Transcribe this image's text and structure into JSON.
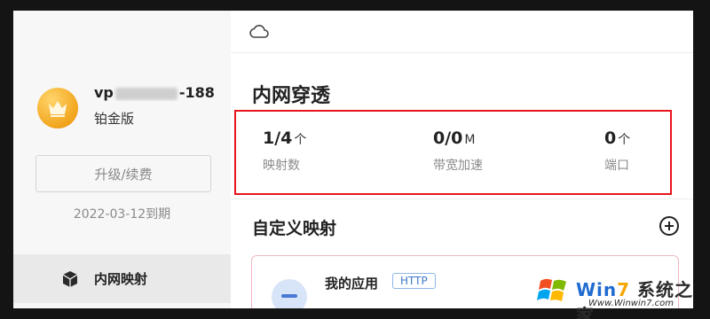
{
  "sidebar": {
    "user": {
      "name_prefix": "vp",
      "name_suffix": "-188",
      "plan": "铂金版"
    },
    "upgrade_label": "升级/续费",
    "expire_text": "2022-03-12到期",
    "nav": [
      {
        "label": "内网映射",
        "icon": "cube-icon",
        "active": true
      }
    ]
  },
  "header": {
    "icon": "cloud-icon"
  },
  "main": {
    "title": "内网穿透",
    "stats": [
      {
        "value": "1/4",
        "unit": "个",
        "label": "映射数"
      },
      {
        "value": "0/0",
        "unit": "M",
        "label": "带宽加速"
      },
      {
        "value": "0",
        "unit": "个",
        "label": "端口"
      }
    ],
    "section_title": "自定义映射",
    "add_icon": "plus-circle-icon",
    "apps": [
      {
        "name": "我的应用",
        "protocol": "HTTP"
      }
    ]
  },
  "watermark": {
    "brand_part1": "Win",
    "brand_part2": "7",
    "brand_cn": "系统之家",
    "url": "Www.Winwin7.com"
  },
  "colors": {
    "highlight_border": "#e8141c",
    "avatar_gold": "#f2a51d",
    "badge_blue": "#3c78c8"
  }
}
